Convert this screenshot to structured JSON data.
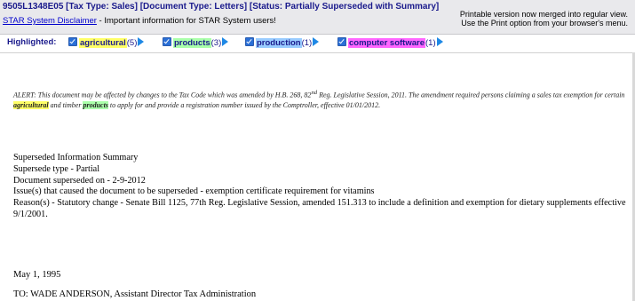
{
  "header": {
    "title": "9505L1348E05 [Tax Type: Sales] [Document Type: Letters] [Status: Partially Superseded with Summary]",
    "disclaimer_link": "STAR System Disclaimer",
    "disclaimer_text": " - Important information for STAR System users!",
    "printable_line1": "Printable version now merged into regular view.",
    "printable_line2": "Use the Print option from your browser's menu."
  },
  "highlighted": {
    "label": "Highlighted:",
    "terms": [
      {
        "word": "agricultural",
        "count": "(5)",
        "color": "#ffff66"
      },
      {
        "word": "products",
        "count": "(3)",
        "color": "#aaffaa"
      },
      {
        "word": "production",
        "count": "(1)",
        "color": "#99ccff"
      },
      {
        "word": "computer software",
        "count": "(1)",
        "color": "#ff66ff"
      }
    ]
  },
  "alert": {
    "part1": "ALERT: This document may be affected by changes to the Tax Code which was amended by H.B. 268, 82",
    "sup": "nd",
    "part2": " Reg. Legislative Session, 2011. The amendment required persons claiming a sales tax exemption for certain ",
    "kw1": "agricultural",
    "part3": " and timber ",
    "kw2": "products",
    "part4": " to apply for and provide a registration number issued by the Comptroller, effective 01/01/2012."
  },
  "summary": {
    "heading": "Superseded Information Summary",
    "type_line": "Supersede type - Partial",
    "date_line": "Document superseded on - 2-9-2012",
    "issue_line": "Issue(s) that caused the document to be superseded - exemption certificate requirement for vitamins",
    "reason_line": "Reason(s) - Statutory change - Senate Bill 1125, 77th Reg. Legislative Session, amended 151.313 to include a definition and exemption for dietary supplements effective 9/1/2001."
  },
  "letter": {
    "date": "May 1, 1995",
    "to": "TO: WADE ANDERSON, Assistant Director Tax Administration"
  }
}
